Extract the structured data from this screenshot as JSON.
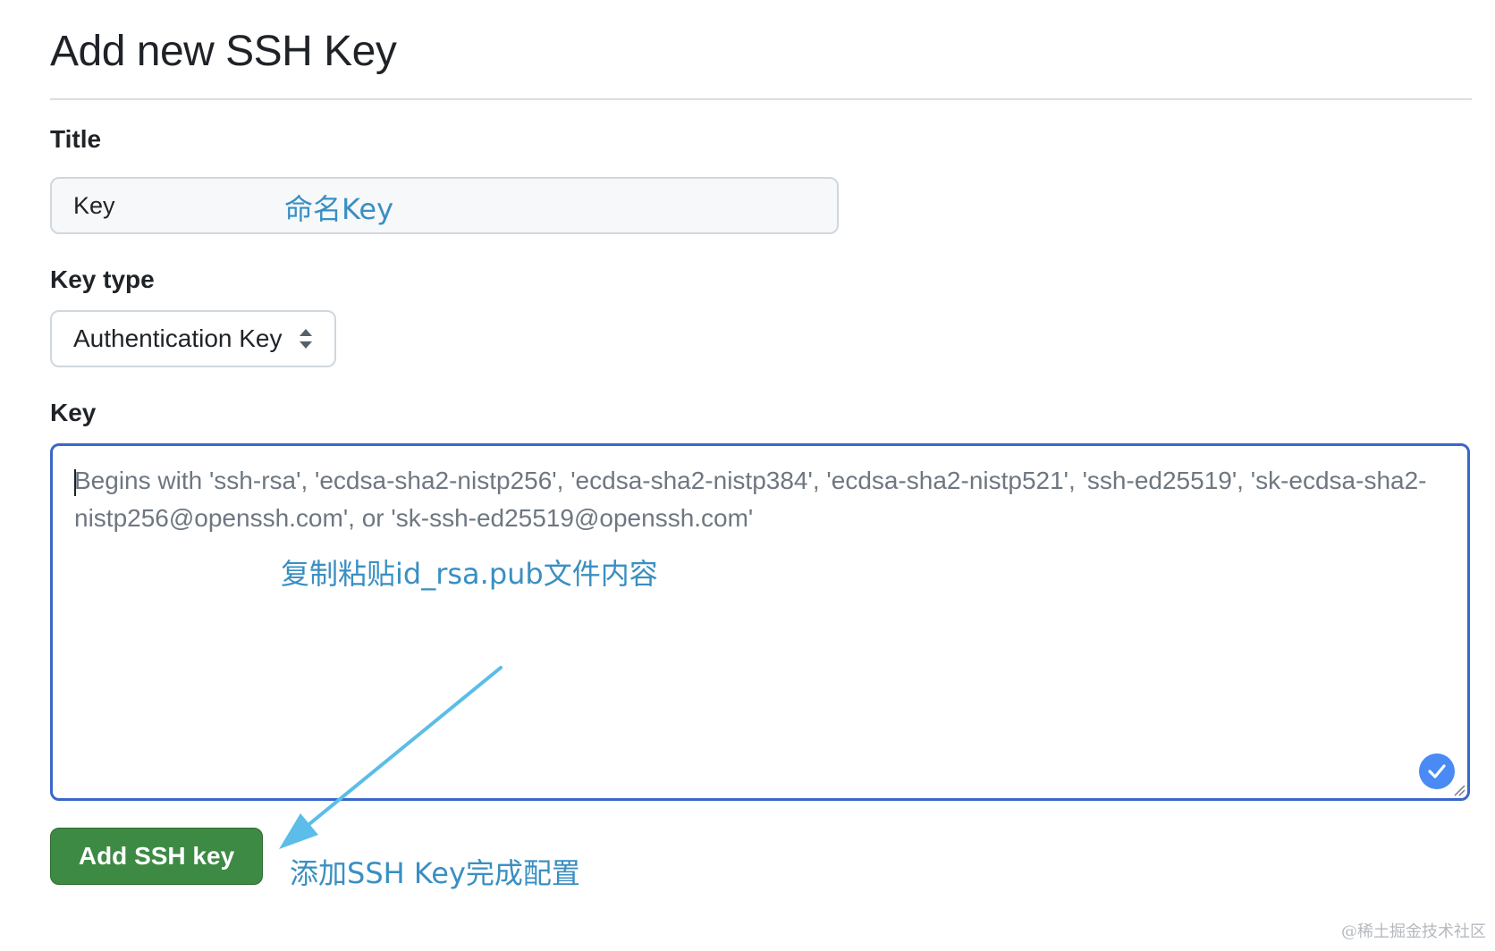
{
  "page": {
    "title": "Add new SSH Key"
  },
  "form": {
    "title_label": "Title",
    "title_value": "Key",
    "key_type_label": "Key type",
    "key_type_selected": "Authentication Key",
    "key_label": "Key",
    "key_placeholder": "Begins with 'ssh-rsa', 'ecdsa-sha2-nistp256', 'ecdsa-sha2-nistp384', 'ecdsa-sha2-nistp521', 'ssh-ed25519', 'sk-ecdsa-sha2-nistp256@openssh.com', or 'sk-ssh-ed25519@openssh.com'",
    "submit_label": "Add SSH key"
  },
  "annotations": {
    "name_key": "命名Key",
    "paste_content": "复制粘贴id_rsa.pub文件内容",
    "add_complete": "添加SSH Key完成配置"
  },
  "watermark": "@稀土掘金技术社区",
  "colors": {
    "annotation": "#3a8fc2",
    "arrow": "#5bbde8",
    "button": "#3d8a44",
    "focus_border": "#3b67c9",
    "check_badge": "#4a8af4"
  },
  "icons": {
    "select_caret": "up-down-caret-icon",
    "check": "checkmark-icon",
    "resize": "resize-handle-icon",
    "arrow": "arrow-annotation-icon"
  }
}
